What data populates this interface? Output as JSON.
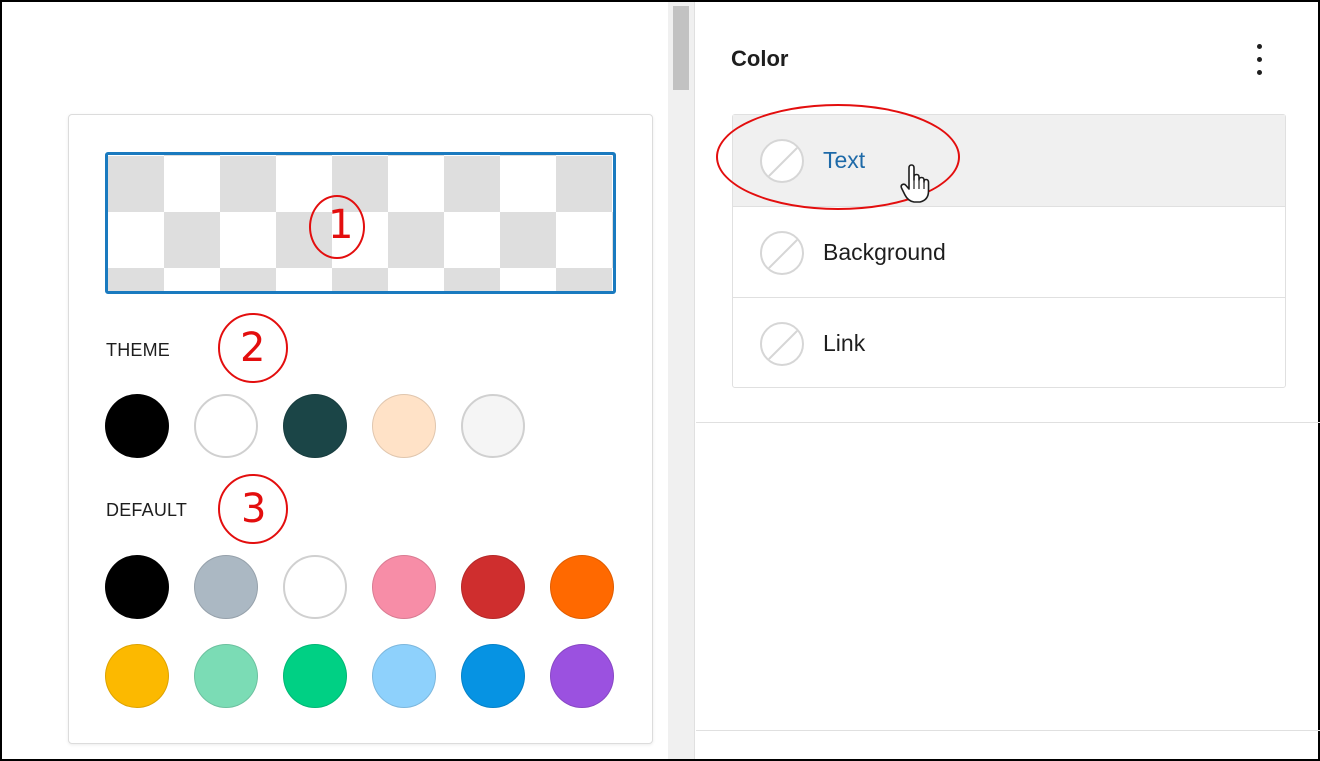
{
  "palette": {
    "sections": {
      "theme_label": "THEME",
      "default_label": "DEFAULT"
    },
    "theme_colors": [
      {
        "name": "black",
        "hex": "#000000"
      },
      {
        "name": "white",
        "hex": "#ffffff"
      },
      {
        "name": "dark-teal",
        "hex": "#1b4547"
      },
      {
        "name": "peach",
        "hex": "#ffe2c7"
      },
      {
        "name": "light-gray",
        "hex": "#f5f5f5"
      }
    ],
    "default_colors": [
      {
        "name": "black",
        "hex": "#000000"
      },
      {
        "name": "cyan-bluish-gray",
        "hex": "#abb8c3"
      },
      {
        "name": "white",
        "hex": "#ffffff"
      },
      {
        "name": "pale-pink",
        "hex": "#f78da7"
      },
      {
        "name": "vivid-red",
        "hex": "#cf2e2e"
      },
      {
        "name": "luminous-vivid-orange",
        "hex": "#ff6900"
      },
      {
        "name": "luminous-vivid-amber",
        "hex": "#fcb900"
      },
      {
        "name": "light-green-cyan",
        "hex": "#7bdcb5"
      },
      {
        "name": "vivid-green-cyan",
        "hex": "#00d084"
      },
      {
        "name": "pale-cyan-blue",
        "hex": "#8ed1fc"
      },
      {
        "name": "vivid-cyan-blue",
        "hex": "#0693e3"
      },
      {
        "name": "vivid-purple",
        "hex": "#9b51e0"
      }
    ],
    "annotations": [
      "1",
      "2",
      "3"
    ],
    "accent": "#1a7abf",
    "annotation_color": "#e30e0e"
  },
  "color_panel": {
    "title": "Color",
    "menu_icon": "more-vertical-icon",
    "items": [
      {
        "label": "Text",
        "active": true
      },
      {
        "label": "Background",
        "active": false
      },
      {
        "label": "Link",
        "active": false
      }
    ]
  }
}
